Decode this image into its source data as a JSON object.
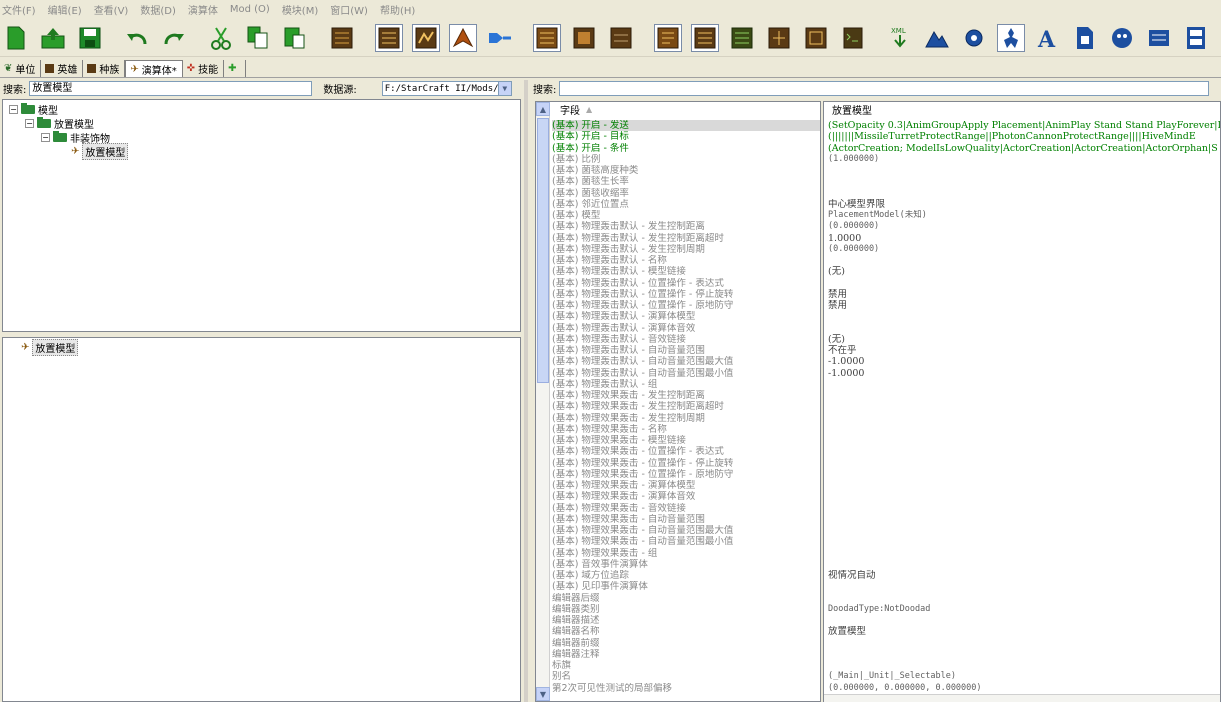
{
  "menu": [
    "文件(F)",
    "编辑(E)",
    "查看(V)",
    "数据(D)",
    "演算体",
    "Mod (O)",
    "模块(M)",
    "窗口(W)",
    "帮助(H)"
  ],
  "tabs": [
    {
      "label": "单位",
      "icon": "unit-icon"
    },
    {
      "label": "英雄",
      "icon": "hero-icon"
    },
    {
      "label": "种族",
      "icon": "race-icon"
    },
    {
      "label": "演算体*",
      "icon": "actor-icon"
    },
    {
      "label": "技能",
      "icon": "ability-icon"
    },
    {
      "label": "",
      "icon": "add-icon"
    }
  ],
  "left_search": {
    "label": "搜索:",
    "value": "放置模型",
    "datasource_label": "数据源:",
    "datasource_value": "F:/StarCraft II/Mods/"
  },
  "tree": {
    "root": "模型",
    "child": "放置模型",
    "group": "非装饰物",
    "leaf": "放置模型"
  },
  "tree2": {
    "item": "放置模型"
  },
  "right_search": {
    "label": "搜索:",
    "value": ""
  },
  "fields_header": "字段",
  "values_header": "放置模型",
  "fields": [
    "(基本) 开启 - 发送",
    "(基本) 开启 - 目标",
    "(基本) 开启 - 条件",
    "(基本) 比例",
    "(基本) 菌毯高度种类",
    "(基本) 菌毯生长率",
    "(基本) 菌毯收缩率",
    "(基本) 邻近位置点",
    "(基本) 模型",
    "(基本) 物理轰击默认 - 发生控制距离",
    "(基本) 物理轰击默认 - 发生控制距离超时",
    "(基本) 物理轰击默认 - 发生控制周期",
    "(基本) 物理轰击默认 - 名称",
    "(基本) 物理轰击默认 - 模型链接",
    "(基本) 物理轰击默认 - 位置操作 - 表达式",
    "(基本) 物理轰击默认 - 位置操作 - 停止旋转",
    "(基本) 物理轰击默认 - 位置操作 - 原地防守",
    "(基本) 物理轰击默认 - 演算体模型",
    "(基本) 物理轰击默认 - 演算体音效",
    "(基本) 物理轰击默认 - 音效链接",
    "(基本) 物理轰击默认 - 自动音量范围",
    "(基本) 物理轰击默认 - 自动音量范围最大值",
    "(基本) 物理轰击默认 - 自动音量范围最小值",
    "(基本) 物理轰击默认 - 组",
    "(基本) 物理效果轰击 - 发生控制距离",
    "(基本) 物理效果轰击 - 发生控制距离超时",
    "(基本) 物理效果轰击 - 发生控制周期",
    "(基本) 物理效果轰击 - 名称",
    "(基本) 物理效果轰击 - 模型链接",
    "(基本) 物理效果轰击 - 位置操作 - 表达式",
    "(基本) 物理效果轰击 - 位置操作 - 停止旋转",
    "(基本) 物理效果轰击 - 位置操作 - 原地防守",
    "(基本) 物理效果轰击 - 演算体模型",
    "(基本) 物理效果轰击 - 演算体音效",
    "(基本) 物理效果轰击 - 音效链接",
    "(基本) 物理效果轰击 - 自动音量范围",
    "(基本) 物理效果轰击 - 自动音量范围最大值",
    "(基本) 物理效果轰击 - 自动音量范围最小值",
    "(基本) 物理效果轰击 - 组",
    "(基本) 音效事件演算体",
    "(基本) 域方位追踪",
    "(基本) 见印事件演算体",
    "编辑器后缀",
    "编辑器类别",
    "编辑器描述",
    "编辑器名称",
    "编辑器前缀",
    "编辑器注释",
    "标旗",
    "别名",
    "第2次可见性测试的局部偏移"
  ],
  "values": {
    "v0": "(SetOpacity 0.3|AnimGroupApply Placement|AnimPlay Stand Stand PlayForever|D",
    "v1": "(|||||||MissileTurretProtectRange||PhotonCannonProtectRange||||HiveMindE",
    "v2": "(ActorCreation; ModelIsLowQuality|ActorCreation|ActorCreation|ActorOrphan|S",
    "v3": "(1.000000)",
    "v7": "中心模型界限",
    "v8": "PlacementModel(未知)",
    "v9": "(0.000000)",
    "v10": "1.0000",
    "v11": "(0.000000)",
    "v13": "(无)",
    "v15": "禁用",
    "v16": "禁用",
    "v19": "(无)",
    "v20": "不在乎",
    "v21": "-1.0000",
    "v22": "-1.0000",
    "v40": "视情况自动",
    "v43": "DoodadType:NotDoodad",
    "v45": "放置模型",
    "v49": "(_Main|_Unit|_Selectable)",
    "v50": "(0.000000, 0.000000, 0.000000)"
  },
  "colors": {
    "green": "#008000",
    "accent": "#316ac5"
  }
}
